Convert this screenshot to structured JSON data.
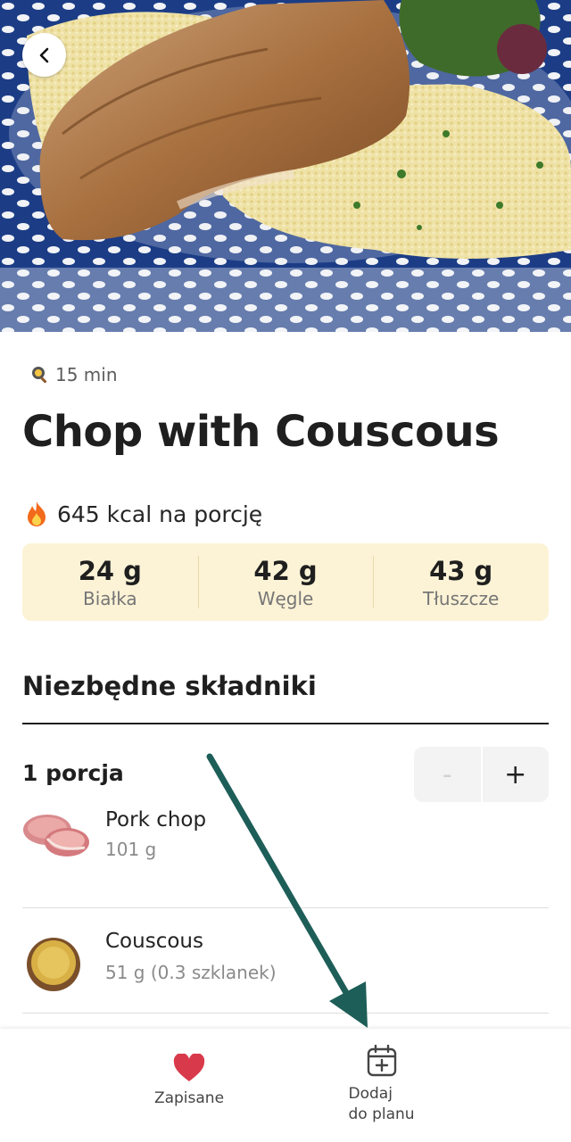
{
  "recipe": {
    "prep_time": "15 min",
    "title": "Chop with Couscous",
    "calories": "645 kcal na porcję",
    "macros": [
      {
        "value": "24 g",
        "label": "Białka"
      },
      {
        "value": "42 g",
        "label": "Węgle"
      },
      {
        "value": "43 g",
        "label": "Tłuszcze"
      }
    ]
  },
  "ingredients": {
    "section_title": "Niezbędne składniki",
    "portion_label": "1 porcja",
    "stepper": {
      "minus": "-",
      "plus": "+"
    },
    "items": [
      {
        "name": "Pork chop",
        "amount": "101 g"
      },
      {
        "name": "Couscous",
        "amount": "51 g (0.3 szklanek)"
      }
    ]
  },
  "bottom_nav": {
    "saved_label": "Zapisane",
    "add_to_plan_line1": "Dodaj",
    "add_to_plan_line2": "do planu"
  },
  "colors": {
    "macros_bg": "#fcf3d6",
    "heart": "#d93a4b",
    "annotation_arrow": "#1e5e58"
  },
  "icons": [
    "back-chevron-icon",
    "frying-pan-icon",
    "fire-icon",
    "heart-icon",
    "calendar-plus-icon"
  ]
}
